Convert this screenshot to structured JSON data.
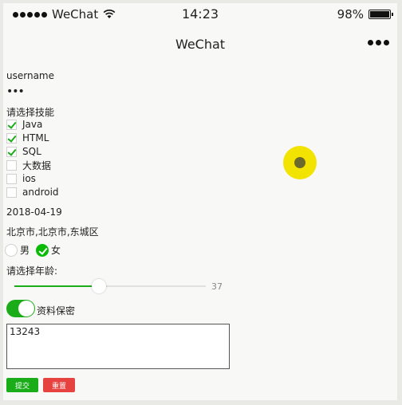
{
  "status": {
    "carrier": "WeChat",
    "time": "14:23",
    "battery": "98%",
    "battery_level": 0.98
  },
  "nav": {
    "title": "WeChat"
  },
  "form": {
    "username_label": "username",
    "password_value": "•••",
    "skills_label": "请选择技能",
    "skills": [
      {
        "label": "Java",
        "checked": true
      },
      {
        "label": "HTML",
        "checked": true
      },
      {
        "label": "SQL",
        "checked": true
      },
      {
        "label": "大数据",
        "checked": false
      },
      {
        "label": "ios",
        "checked": false
      },
      {
        "label": "android",
        "checked": false
      }
    ],
    "date": "2018-04-19",
    "region": "北京市,北京市,东城区",
    "gender_options": [
      {
        "label": "男",
        "checked": false
      },
      {
        "label": "女",
        "checked": true
      }
    ],
    "age_label": "请选择年龄:",
    "age_value": "37",
    "age_fraction": 0.37,
    "privacy_label": "资料保密",
    "privacy_on": true,
    "textarea_value": "13243",
    "submit_label": "提交",
    "reset_label": "重置"
  }
}
